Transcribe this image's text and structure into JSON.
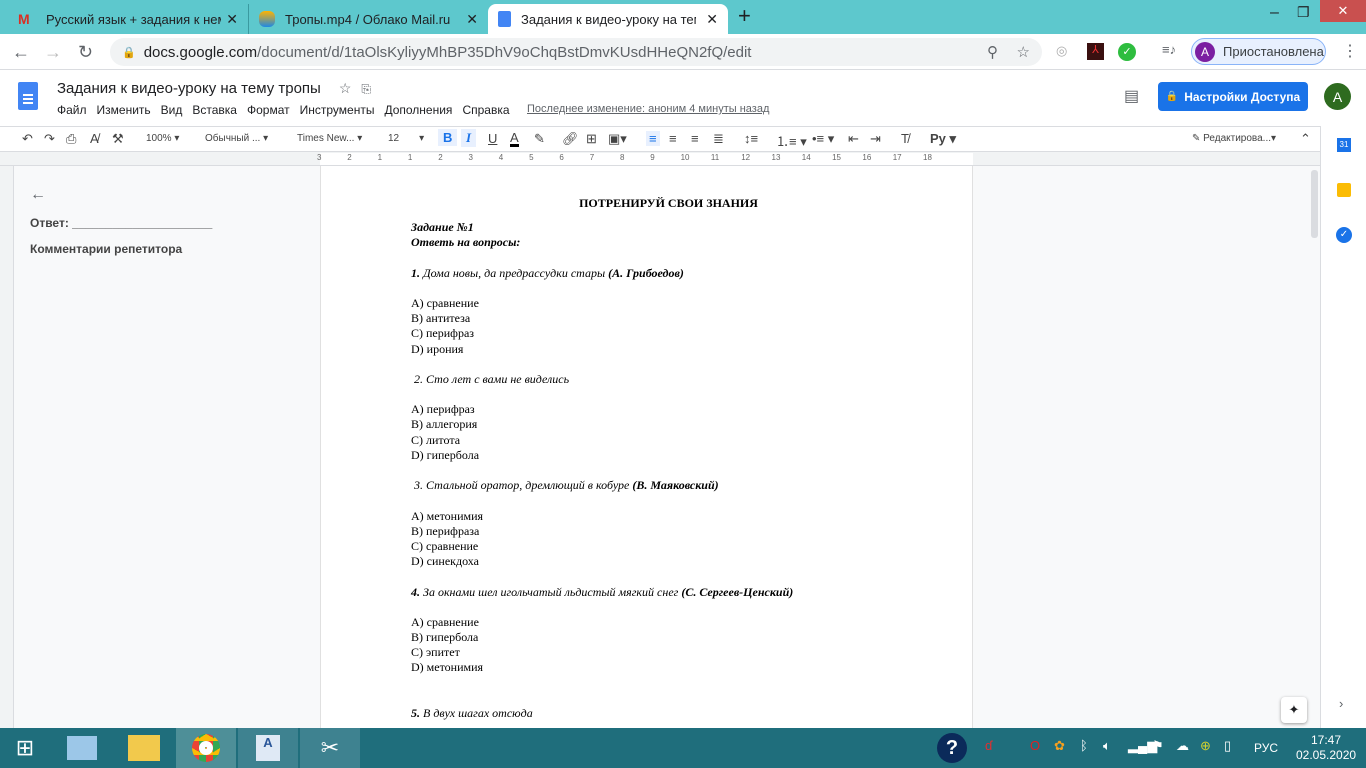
{
  "browser": {
    "tabs": [
      {
        "label": "Русский язык + задания к нему",
        "icon": "gmail-icon"
      },
      {
        "label": "Тропы.mp4 / Облако Mail.ru",
        "icon": "mail-cloud-icon"
      },
      {
        "label": "Задания к видео-уроку на тему",
        "icon": "docs-icon"
      }
    ],
    "url_host": "docs.google.com",
    "url_path": "/document/d/1taOlsKyliyyMhBP35DhV9oChqBstDmvKUsdHHeQN2fQ/edit",
    "profile_initial": "A",
    "profile_label": "Приостановлена"
  },
  "docs": {
    "title": "Задания к видео-уроку на тему тропы",
    "menu": [
      "Файл",
      "Изменить",
      "Вид",
      "Вставка",
      "Формат",
      "Инструменты",
      "Дополнения",
      "Справка"
    ],
    "last_edit": "Последнее изменение: аноним 4 минуты назад",
    "share_label": "Настройки Доступа",
    "account_initial": "A",
    "toolbar": {
      "zoom": "100%",
      "style": "Обычный ...",
      "font": "Times New...",
      "size": "12",
      "mode": "Редактирова..."
    },
    "ruler": [
      "3",
      "2",
      "1",
      "1",
      "2",
      "3",
      "4",
      "5",
      "6",
      "7",
      "8",
      "9",
      "10",
      "11",
      "12",
      "13",
      "14",
      "15",
      "16",
      "17",
      "18"
    ]
  },
  "outline": {
    "answer": "Ответ: _____________________",
    "comments": "Комментарии репетитора"
  },
  "document": {
    "heading": "ПОТРЕНИРУЙ СВОИ ЗНАНИЯ",
    "lines": [
      [
        {
          "t": "Задание №1",
          "b": 1,
          "i": 1
        }
      ],
      [
        {
          "t": "Ответь на вопросы:",
          "b": 1,
          "i": 1
        }
      ],
      [],
      [
        {
          "t": "1. ",
          "b": 1,
          "i": 1
        },
        {
          "t": "Дома новы, да предрассудки стары ",
          "i": 1
        },
        {
          "t": "(А. Грибоедов)",
          "b": 1,
          "i": 1
        }
      ],
      [],
      [
        {
          "t": "А) сравнение"
        }
      ],
      [
        {
          "t": "В) антитеза"
        }
      ],
      [
        {
          "t": "С) перифраз"
        }
      ],
      [
        {
          "t": "D) ирония"
        }
      ],
      [],
      [
        {
          "t": " 2. ",
          "i": 1
        },
        {
          "t": "Сто лет с вами не виделись",
          "i": 1
        }
      ],
      [],
      [
        {
          "t": "А) перифраз"
        }
      ],
      [
        {
          "t": "В) аллегория"
        }
      ],
      [
        {
          "t": "С) литота"
        }
      ],
      [
        {
          "t": "D) гипербола"
        }
      ],
      [],
      [
        {
          "t": " 3. ",
          "i": 1
        },
        {
          "t": "Стальной оратор, дремлющий в кобуре ",
          "i": 1
        },
        {
          "t": "(В. Маяковский)",
          "b": 1,
          "i": 1
        }
      ],
      [],
      [
        {
          "t": "А) метонимия"
        }
      ],
      [
        {
          "t": "В) перифраза"
        }
      ],
      [
        {
          "t": "С) сравнение"
        }
      ],
      [
        {
          "t": "D) синекдоха"
        }
      ],
      [],
      [
        {
          "t": "4. ",
          "b": 1,
          "i": 1
        },
        {
          "t": "За окнами шел игольчатый льдистый мягкий снег ",
          "i": 1
        },
        {
          "t": "(С. Сергеев-Ценский)",
          "b": 1,
          "i": 1
        }
      ],
      [],
      [
        {
          "t": "А) сравнение"
        }
      ],
      [
        {
          "t": "В) гипербола"
        }
      ],
      [
        {
          "t": "С) эпитет"
        }
      ],
      [
        {
          "t": "D) метонимия"
        }
      ],
      [],
      [],
      [
        {
          "t": "5. ",
          "b": 1,
          "i": 1
        },
        {
          "t": "В двух шагах отсюда",
          "i": 1
        }
      ]
    ]
  },
  "taskbar": {
    "lang": "РУС",
    "time": "17:47",
    "date": "02.05.2020"
  },
  "colors": {
    "tabbar": "#5dc8cd",
    "accent": "#1a73e8",
    "taskbar": "#1f6e7c"
  }
}
